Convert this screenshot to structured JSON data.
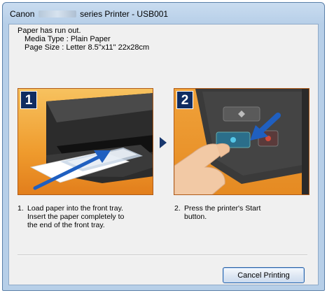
{
  "window": {
    "title_prefix": "Canon",
    "title_suffix": "series Printer - USB001"
  },
  "message": {
    "line1": "Paper has run out.",
    "line2": "Media Type : Plain Paper",
    "line3": "Page Size : Letter 8.5\"x11\" 22x28cm"
  },
  "steps": [
    {
      "badge": "1",
      "number": "1.",
      "text_line1": "Load paper into the front tray.",
      "text_line2": "Insert the paper completely to",
      "text_line3": "the end of the front tray."
    },
    {
      "badge": "2",
      "number": "2.",
      "text_line1": "Press the printer's Start",
      "text_line2": "button."
    }
  ],
  "buttons": {
    "cancel_label": "Cancel Printing"
  },
  "colors": {
    "badge": "#0f2c61",
    "arrow": "#1f5fc0",
    "panel_orange": "#ef9b2d"
  }
}
